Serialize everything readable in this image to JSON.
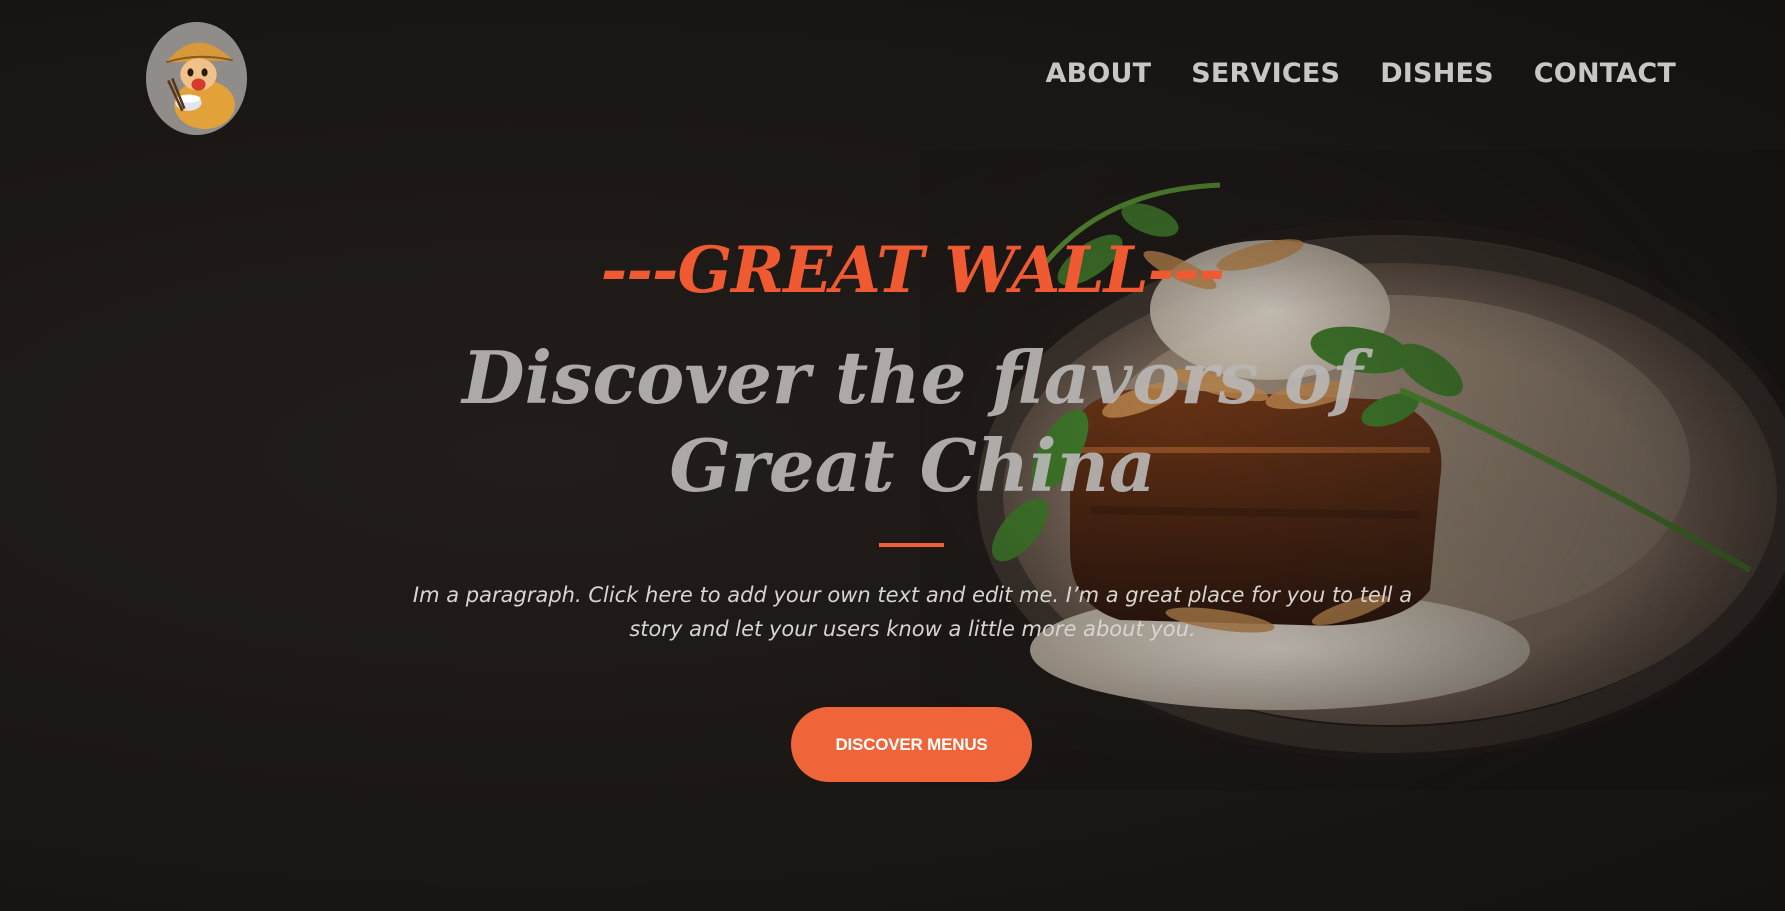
{
  "header": {
    "logo_name": "chef-mascot-logo",
    "nav": [
      {
        "label": "ABOUT"
      },
      {
        "label": "SERVICES"
      },
      {
        "label": "DISHES"
      },
      {
        "label": "CONTACT"
      }
    ]
  },
  "hero": {
    "eyebrow": "---GREAT WALL---",
    "headline": "Discover the flavors of Great China",
    "paragraph": "Im a paragraph. Click here to add your own text and edit me. I’m a great place for you to tell a story and let your users know a little more about you.",
    "cta_label": "DISCOVER MENUS"
  },
  "colors": {
    "accent": "#f05a33",
    "background": "#1a1614",
    "nav_text": "#c9c6c3",
    "headline_text": "#b9b6b4"
  }
}
